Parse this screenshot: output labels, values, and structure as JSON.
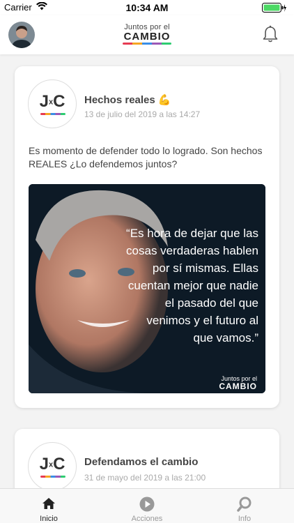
{
  "status_bar": {
    "carrier": "Carrier",
    "time": "10:34 AM"
  },
  "header": {
    "logo_line1": "Juntos por el",
    "logo_line2": "CAMBIO",
    "avatar_icon": "user-avatar",
    "bell_icon": "bell-icon"
  },
  "posts": [
    {
      "avatar_text": "JxC",
      "title": "Hechos reales 💪",
      "date": "13 de julio del 2019 a las  14:27",
      "text": "Es momento de defender todo lo logrado. Son hechos REALES ¿Lo defendemos juntos?",
      "image_quote": "“Es hora de dejar que las cosas verdaderas hablen por sí mismas. Ellas cuentan mejor que nadie el pasado del que venimos y el futuro al que vamos.”",
      "image_logo1": "Juntos por el",
      "image_logo2": "CAMBIO"
    },
    {
      "avatar_text": "JxC",
      "title": "Defendamos el cambio",
      "date": "31 de mayo del 2019 a las  21:00"
    }
  ],
  "tabs": [
    {
      "label": "Inicio",
      "icon": "home-icon",
      "active": true
    },
    {
      "label": "Acciones",
      "icon": "play-icon",
      "active": false
    },
    {
      "label": "Info",
      "icon": "search-icon",
      "active": false
    }
  ],
  "colors": {
    "accent": "#222222",
    "inactive": "#999999"
  }
}
